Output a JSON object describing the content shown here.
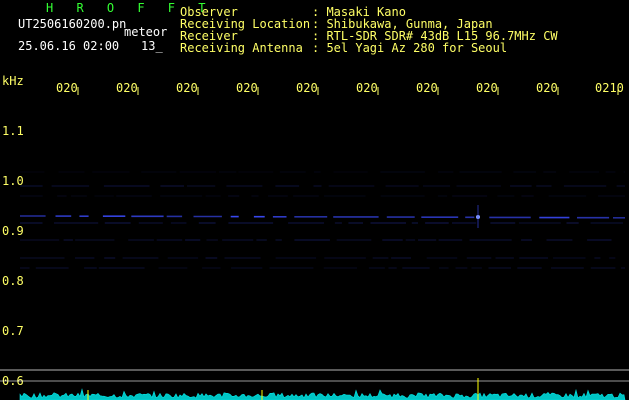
{
  "header": {
    "brand": "H R O F F T",
    "filename": "UT2506160200.pn",
    "mode": "meteor",
    "datetime": "25.06.16 02:00",
    "count": "13_",
    "info": [
      {
        "label": "Observer",
        "value": ": Masaki Kano"
      },
      {
        "label": "Receiving Location",
        "value": ": Shibukawa, Gunma, Japan"
      },
      {
        "label": "Receiver",
        "value": ": RTL-SDR SDR# 43dB L15 96.7MHz CW"
      },
      {
        "label": "Receiving Antenna",
        "value": ": 5el Yagi Az 280 for Seoul"
      }
    ]
  },
  "axis": {
    "unit": "kHz",
    "y_ticks": [
      "1.1",
      "1.0",
      "0.9",
      "0.8",
      "0.7",
      "0.6"
    ],
    "x_ticks": [
      "020",
      "020",
      "020",
      "020",
      "020",
      "020",
      "020",
      "020",
      "020",
      "0210"
    ]
  },
  "colors": {
    "header_text": "#ffff66",
    "brand": "#33ff33",
    "echo": "#3b4cff",
    "spectrum": "#00e6e6",
    "spike": "#ffff00",
    "grid": "#ffffff"
  }
}
